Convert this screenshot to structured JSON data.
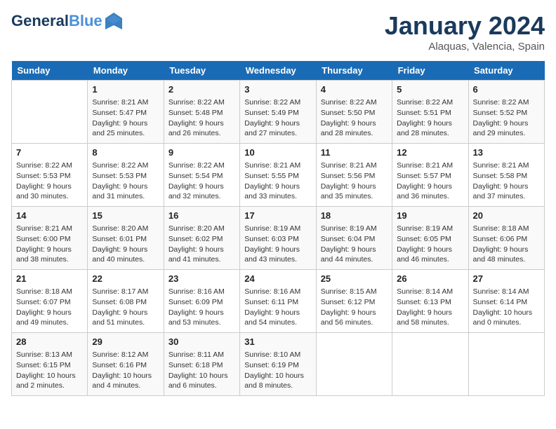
{
  "header": {
    "logo_line1": "General",
    "logo_line2": "Blue",
    "month": "January 2024",
    "location": "Alaquas, Valencia, Spain"
  },
  "columns": [
    "Sunday",
    "Monday",
    "Tuesday",
    "Wednesday",
    "Thursday",
    "Friday",
    "Saturday"
  ],
  "weeks": [
    [
      {
        "day": "",
        "content": ""
      },
      {
        "day": "1",
        "content": "Sunrise: 8:21 AM\nSunset: 5:47 PM\nDaylight: 9 hours\nand 25 minutes."
      },
      {
        "day": "2",
        "content": "Sunrise: 8:22 AM\nSunset: 5:48 PM\nDaylight: 9 hours\nand 26 minutes."
      },
      {
        "day": "3",
        "content": "Sunrise: 8:22 AM\nSunset: 5:49 PM\nDaylight: 9 hours\nand 27 minutes."
      },
      {
        "day": "4",
        "content": "Sunrise: 8:22 AM\nSunset: 5:50 PM\nDaylight: 9 hours\nand 28 minutes."
      },
      {
        "day": "5",
        "content": "Sunrise: 8:22 AM\nSunset: 5:51 PM\nDaylight: 9 hours\nand 28 minutes."
      },
      {
        "day": "6",
        "content": "Sunrise: 8:22 AM\nSunset: 5:52 PM\nDaylight: 9 hours\nand 29 minutes."
      }
    ],
    [
      {
        "day": "7",
        "content": "Sunrise: 8:22 AM\nSunset: 5:53 PM\nDaylight: 9 hours\nand 30 minutes."
      },
      {
        "day": "8",
        "content": "Sunrise: 8:22 AM\nSunset: 5:53 PM\nDaylight: 9 hours\nand 31 minutes."
      },
      {
        "day": "9",
        "content": "Sunrise: 8:22 AM\nSunset: 5:54 PM\nDaylight: 9 hours\nand 32 minutes."
      },
      {
        "day": "10",
        "content": "Sunrise: 8:21 AM\nSunset: 5:55 PM\nDaylight: 9 hours\nand 33 minutes."
      },
      {
        "day": "11",
        "content": "Sunrise: 8:21 AM\nSunset: 5:56 PM\nDaylight: 9 hours\nand 35 minutes."
      },
      {
        "day": "12",
        "content": "Sunrise: 8:21 AM\nSunset: 5:57 PM\nDaylight: 9 hours\nand 36 minutes."
      },
      {
        "day": "13",
        "content": "Sunrise: 8:21 AM\nSunset: 5:58 PM\nDaylight: 9 hours\nand 37 minutes."
      }
    ],
    [
      {
        "day": "14",
        "content": "Sunrise: 8:21 AM\nSunset: 6:00 PM\nDaylight: 9 hours\nand 38 minutes."
      },
      {
        "day": "15",
        "content": "Sunrise: 8:20 AM\nSunset: 6:01 PM\nDaylight: 9 hours\nand 40 minutes."
      },
      {
        "day": "16",
        "content": "Sunrise: 8:20 AM\nSunset: 6:02 PM\nDaylight: 9 hours\nand 41 minutes."
      },
      {
        "day": "17",
        "content": "Sunrise: 8:19 AM\nSunset: 6:03 PM\nDaylight: 9 hours\nand 43 minutes."
      },
      {
        "day": "18",
        "content": "Sunrise: 8:19 AM\nSunset: 6:04 PM\nDaylight: 9 hours\nand 44 minutes."
      },
      {
        "day": "19",
        "content": "Sunrise: 8:19 AM\nSunset: 6:05 PM\nDaylight: 9 hours\nand 46 minutes."
      },
      {
        "day": "20",
        "content": "Sunrise: 8:18 AM\nSunset: 6:06 PM\nDaylight: 9 hours\nand 48 minutes."
      }
    ],
    [
      {
        "day": "21",
        "content": "Sunrise: 8:18 AM\nSunset: 6:07 PM\nDaylight: 9 hours\nand 49 minutes."
      },
      {
        "day": "22",
        "content": "Sunrise: 8:17 AM\nSunset: 6:08 PM\nDaylight: 9 hours\nand 51 minutes."
      },
      {
        "day": "23",
        "content": "Sunrise: 8:16 AM\nSunset: 6:09 PM\nDaylight: 9 hours\nand 53 minutes."
      },
      {
        "day": "24",
        "content": "Sunrise: 8:16 AM\nSunset: 6:11 PM\nDaylight: 9 hours\nand 54 minutes."
      },
      {
        "day": "25",
        "content": "Sunrise: 8:15 AM\nSunset: 6:12 PM\nDaylight: 9 hours\nand 56 minutes."
      },
      {
        "day": "26",
        "content": "Sunrise: 8:14 AM\nSunset: 6:13 PM\nDaylight: 9 hours\nand 58 minutes."
      },
      {
        "day": "27",
        "content": "Sunrise: 8:14 AM\nSunset: 6:14 PM\nDaylight: 10 hours\nand 0 minutes."
      }
    ],
    [
      {
        "day": "28",
        "content": "Sunrise: 8:13 AM\nSunset: 6:15 PM\nDaylight: 10 hours\nand 2 minutes."
      },
      {
        "day": "29",
        "content": "Sunrise: 8:12 AM\nSunset: 6:16 PM\nDaylight: 10 hours\nand 4 minutes."
      },
      {
        "day": "30",
        "content": "Sunrise: 8:11 AM\nSunset: 6:18 PM\nDaylight: 10 hours\nand 6 minutes."
      },
      {
        "day": "31",
        "content": "Sunrise: 8:10 AM\nSunset: 6:19 PM\nDaylight: 10 hours\nand 8 minutes."
      },
      {
        "day": "",
        "content": ""
      },
      {
        "day": "",
        "content": ""
      },
      {
        "day": "",
        "content": ""
      }
    ]
  ]
}
